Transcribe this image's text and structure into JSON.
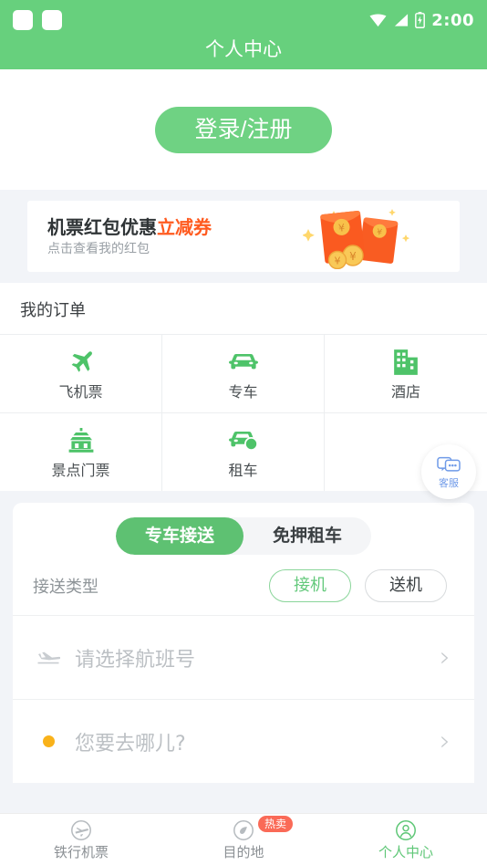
{
  "status_bar": {
    "time": "2:00",
    "icons": [
      "notification-square",
      "notification-square",
      "wifi-icon",
      "signal-icon",
      "battery-charging-icon"
    ]
  },
  "header": {
    "title": "个人中心"
  },
  "login": {
    "button_label": "登录/注册"
  },
  "banner": {
    "title_main": "机票红包优惠",
    "title_highlight": "立减券",
    "subtitle": "点击查看我的红包",
    "highlight_color": "#ff5a1f",
    "art": "red-envelope-coins-illustration"
  },
  "orders": {
    "section_title": "我的订单",
    "items": [
      {
        "label": "飞机票",
        "icon": "plane-icon"
      },
      {
        "label": "专车",
        "icon": "car-icon"
      },
      {
        "label": "酒店",
        "icon": "hotel-building-icon"
      },
      {
        "label": "景点门票",
        "icon": "pagoda-icon"
      },
      {
        "label": "租车",
        "icon": "rental-car-icon"
      },
      {
        "label": "",
        "icon": ""
      }
    ]
  },
  "customer_service": {
    "label": "客服",
    "icon": "chat-bubble-icon",
    "color": "#6f9ae8"
  },
  "booking": {
    "tabs": [
      {
        "label": "专车接送",
        "active": true
      },
      {
        "label": "免押租车",
        "active": false
      }
    ],
    "transfer_type": {
      "label": "接送类型",
      "options": [
        {
          "label": "接机",
          "selected": true
        },
        {
          "label": "送机",
          "selected": false
        }
      ]
    },
    "fields": [
      {
        "placeholder": "请选择航班号",
        "icon": "plane-takeoff-icon",
        "value": ""
      },
      {
        "placeholder": "您要去哪儿?",
        "icon": "orange-dot-icon",
        "value": ""
      }
    ]
  },
  "bottom_nav": {
    "items": [
      {
        "label": "铁行机票",
        "icon": "plane-circle-icon",
        "active": false,
        "badge": ""
      },
      {
        "label": "目的地",
        "icon": "compass-icon",
        "active": false,
        "badge": "热卖"
      },
      {
        "label": "个人中心",
        "icon": "user-circle-icon",
        "active": true,
        "badge": ""
      }
    ]
  },
  "colors": {
    "brand_green": "#67d07d",
    "accent_orange": "#ff5a1f",
    "badge_red": "#fa6a57",
    "page_bg": "#f2f4f8"
  }
}
